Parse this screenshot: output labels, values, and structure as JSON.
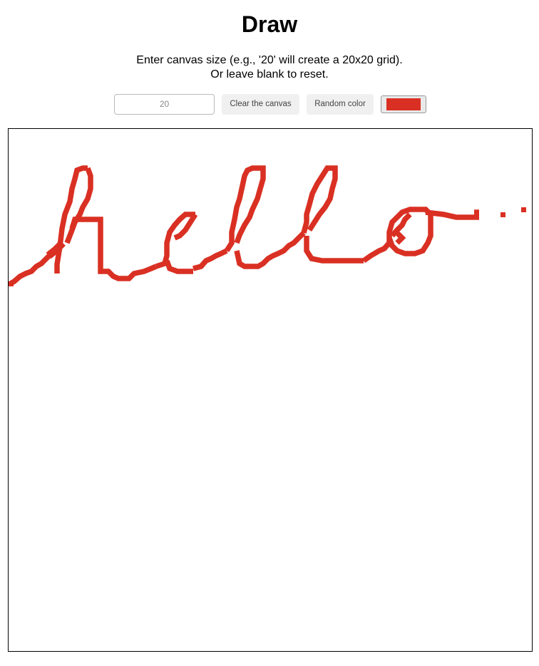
{
  "title": "Draw",
  "instructions": {
    "line1": "Enter canvas size (e.g., '20' will create a 20x20 grid).",
    "line2": "Or leave blank to reset."
  },
  "controls": {
    "size_input_placeholder": "20",
    "size_input_value": "",
    "clear_label": "Clear the canvas",
    "random_label": "Random color",
    "current_color": "#d93023"
  },
  "canvas": {
    "background": "#ffffff",
    "pen_color": "#d93023",
    "drawn_text": "hello"
  }
}
